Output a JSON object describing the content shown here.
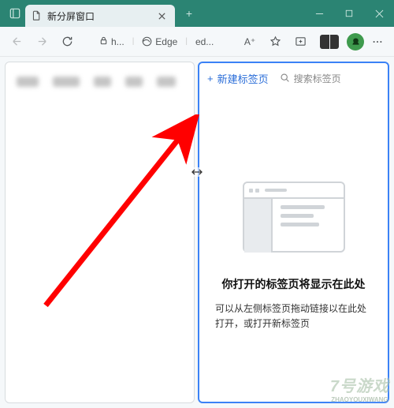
{
  "titlebar": {
    "tab_title": "新分屏窗口"
  },
  "toolbar": {
    "address_short": "h...",
    "edge_label": "Edge",
    "ed_label": "ed...",
    "reader_label": "A⁺"
  },
  "right_pane": {
    "new_tab_label": "新建标签页",
    "search_placeholder": "搜索标签页",
    "empty_title": "你打开的标签页将显示在此处",
    "empty_desc": "可以从左侧标签页拖动链接以在此处打开，或打开新标签页"
  },
  "watermark": {
    "main": "7号游戏",
    "sub": "ZHAOYOUXIWANG"
  }
}
